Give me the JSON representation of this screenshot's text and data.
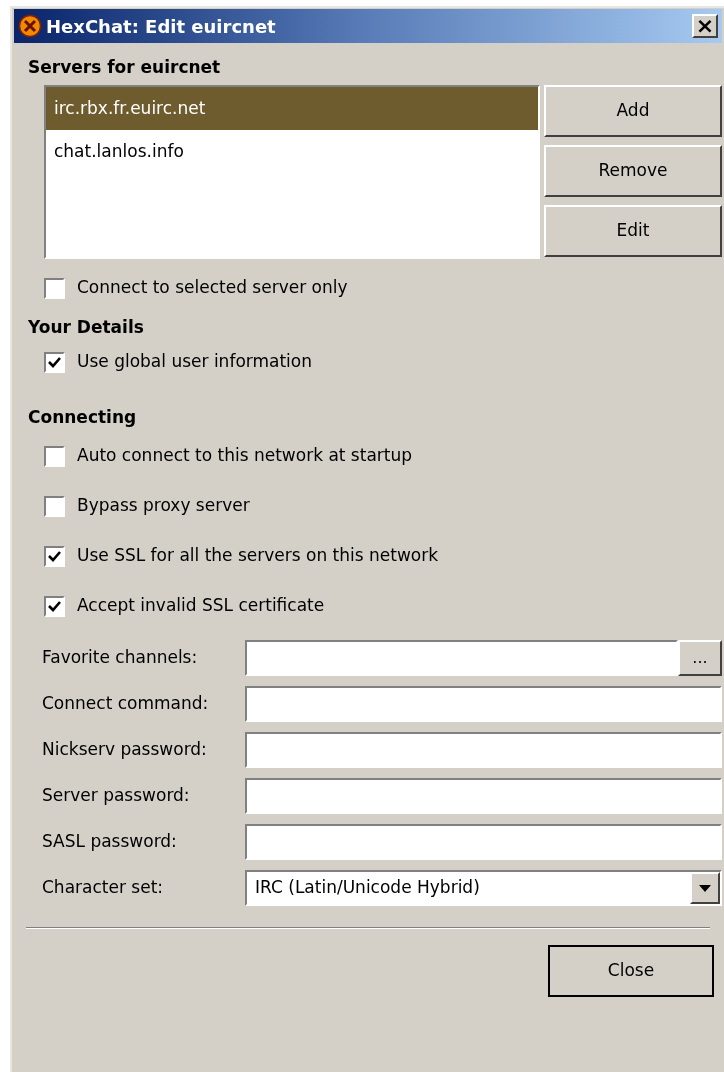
{
  "window": {
    "title": "HexChat: Edit euircnet",
    "close": "×"
  },
  "servers": {
    "heading": "Servers for euircnet",
    "items": [
      {
        "label": "irc.rbx.fr.euirc.net",
        "selected": true
      },
      {
        "label": "chat.lanlos.info",
        "selected": false
      }
    ],
    "buttons": [
      "Add",
      "Remove",
      "Edit"
    ],
    "options": [
      {
        "label": "Connect to selected server only",
        "checked": false
      }
    ]
  },
  "details": {
    "heading": "Your Details",
    "options": [
      {
        "label": "Use global user information",
        "checked": true
      }
    ]
  },
  "connecting": {
    "heading": "Connecting",
    "options": [
      {
        "label": "Auto connect to this network at startup",
        "checked": false
      },
      {
        "label": "Bypass proxy server",
        "checked": false
      },
      {
        "label": "Use SSL for all the servers on this network",
        "checked": true
      },
      {
        "label": "Accept invalid SSL certificate",
        "checked": true
      }
    ]
  },
  "fields": [
    {
      "kind": "text-browse",
      "label": "Favorite channels:",
      "button": "..."
    },
    {
      "kind": "text",
      "label": "Connect command:"
    },
    {
      "kind": "text",
      "label": "Nickserv password:"
    },
    {
      "kind": "text",
      "label": "Server password:"
    },
    {
      "kind": "text",
      "label": "SASL password:"
    },
    {
      "kind": "select",
      "label": "Character set:",
      "value": "IRC (Latin/Unicode Hybrid)"
    }
  ],
  "footer": {
    "button": "Close"
  }
}
